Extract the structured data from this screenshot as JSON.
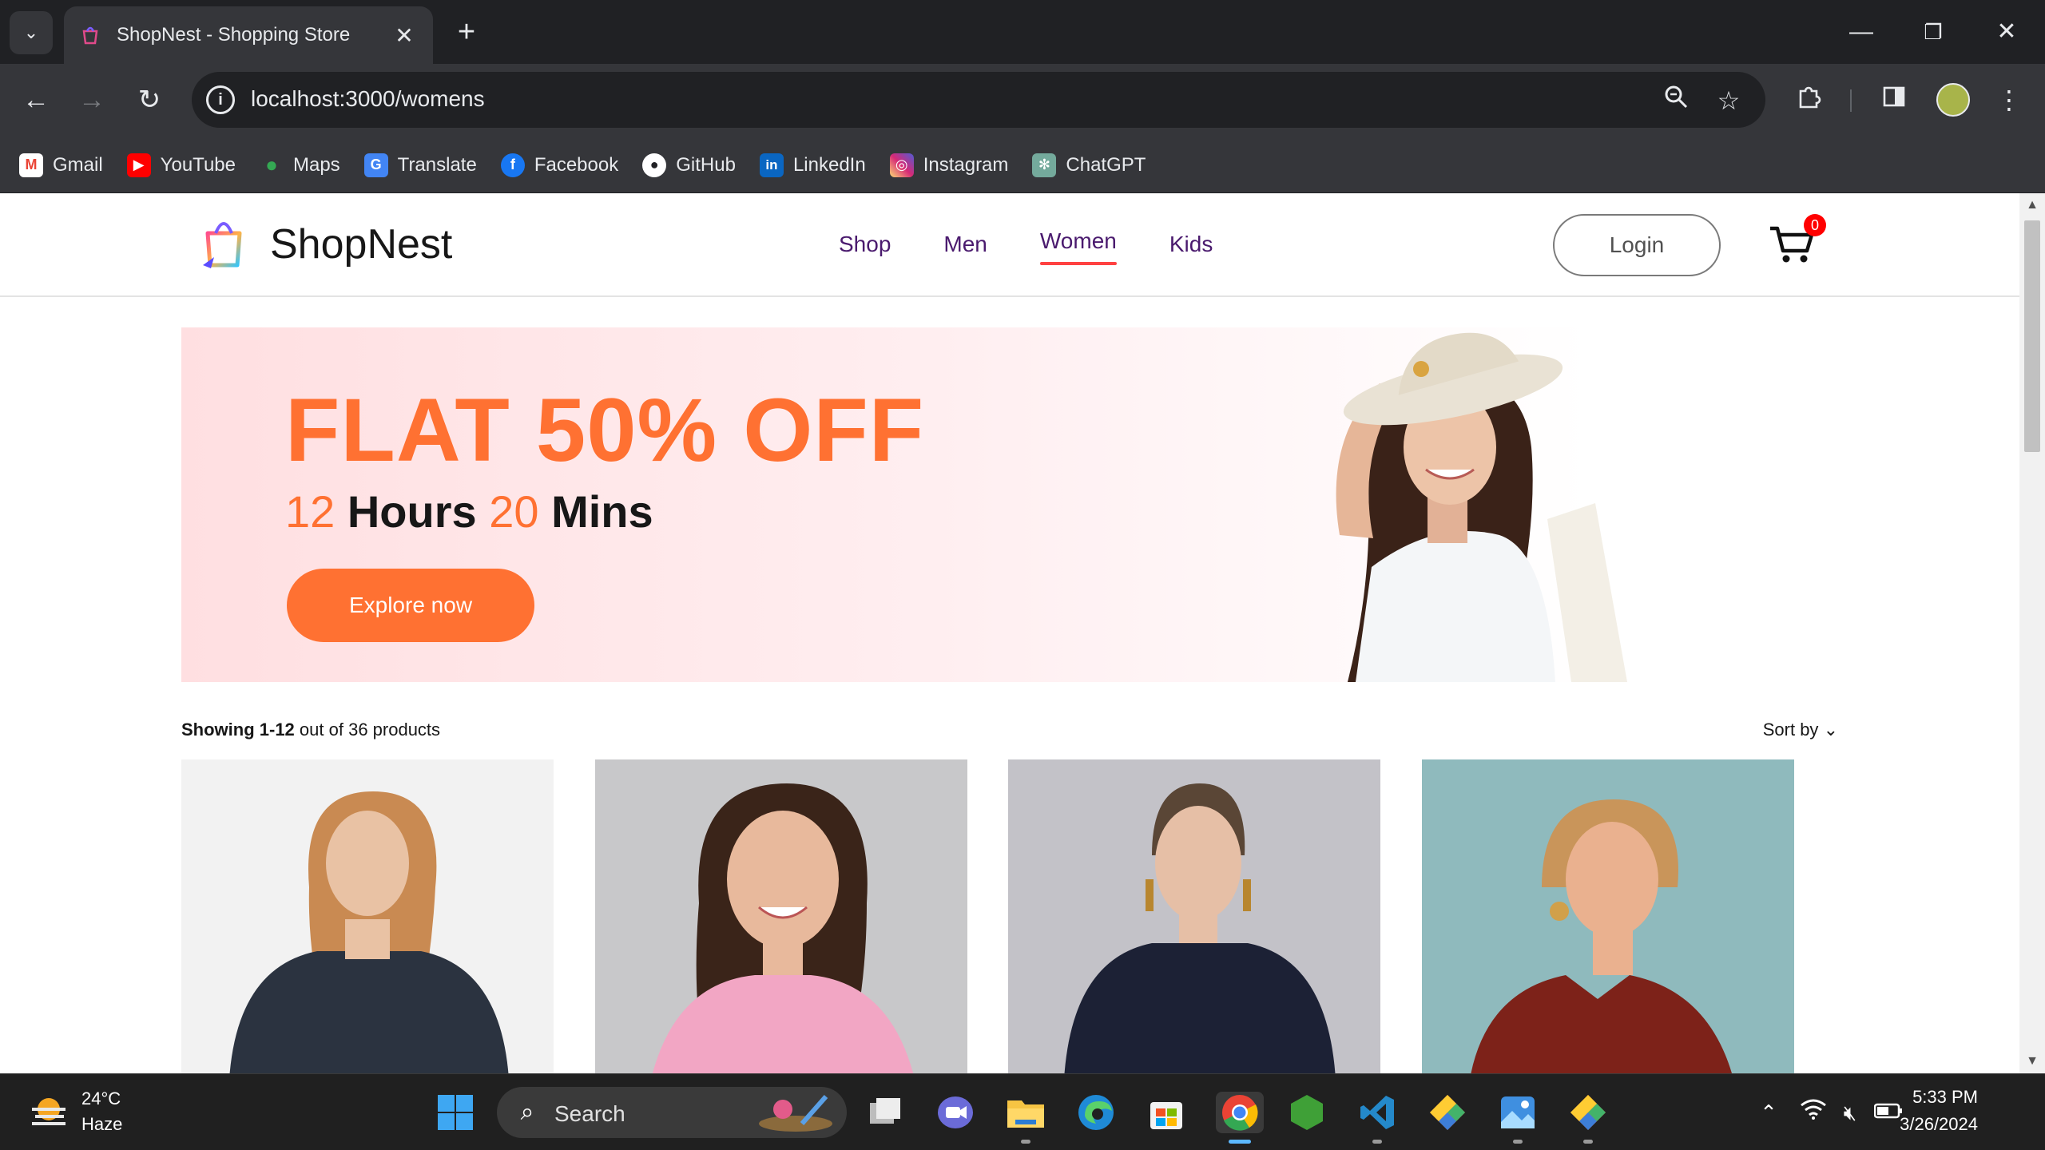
{
  "browser": {
    "tab_title": "ShopNest - Shopping Store",
    "url": "localhost:3000/womens",
    "bookmarks": [
      {
        "label": "Gmail",
        "icon": "gmail-icon",
        "color": "#ea4335"
      },
      {
        "label": "YouTube",
        "icon": "youtube-icon",
        "color": "#ff0000"
      },
      {
        "label": "Maps",
        "icon": "maps-icon",
        "color": "#34a853"
      },
      {
        "label": "Translate",
        "icon": "translate-icon",
        "color": "#4285f4"
      },
      {
        "label": "Facebook",
        "icon": "facebook-icon",
        "color": "#1877f2"
      },
      {
        "label": "GitHub",
        "icon": "github-icon",
        "color": "#ffffff"
      },
      {
        "label": "LinkedIn",
        "icon": "linkedin-icon",
        "color": "#0a66c2"
      },
      {
        "label": "Instagram",
        "icon": "instagram-icon",
        "color": "#d62976"
      },
      {
        "label": "ChatGPT",
        "icon": "chatgpt-icon",
        "color": "#74aa9c"
      }
    ]
  },
  "site": {
    "brand": "ShopNest",
    "menu": [
      {
        "label": "Shop",
        "active": false
      },
      {
        "label": "Men",
        "active": false
      },
      {
        "label": "Women",
        "active": true
      },
      {
        "label": "Kids",
        "active": false
      }
    ],
    "login_label": "Login",
    "cart_count": "0"
  },
  "hero": {
    "title": "FLAT 50% OFF",
    "hours_num": "12",
    "hours_word": "Hours",
    "mins_num": "20",
    "mins_word": "Mins",
    "button": "Explore now",
    "accent": "#ff7132"
  },
  "listing": {
    "showing_bold": "Showing 1-12",
    "showing_rest": "out of 36 products",
    "sort_label": "Sort by"
  },
  "products": [
    {
      "name": "product-1",
      "bg": "#f2f2f2",
      "garment": "#2b3340",
      "hair": "#c98a52",
      "skin": "#e9c2a4"
    },
    {
      "name": "product-2",
      "bg": "#c8c8ca",
      "garment": "#f2a6c4",
      "hair": "#3a2419",
      "skin": "#e8b99c"
    },
    {
      "name": "product-3",
      "bg": "#c3c2c8",
      "garment": "#1c2135",
      "hair": "#5a4636",
      "skin": "#e6bfa6"
    },
    {
      "name": "product-4",
      "bg": "#8fbabd",
      "garment": "#7d2219",
      "hair": "#c9955a",
      "skin": "#eab18f"
    }
  ],
  "taskbar": {
    "weather_temp": "24°C",
    "weather_desc": "Haze",
    "search_label": "Search",
    "time": "5:33 PM",
    "date": "3/26/2024"
  }
}
